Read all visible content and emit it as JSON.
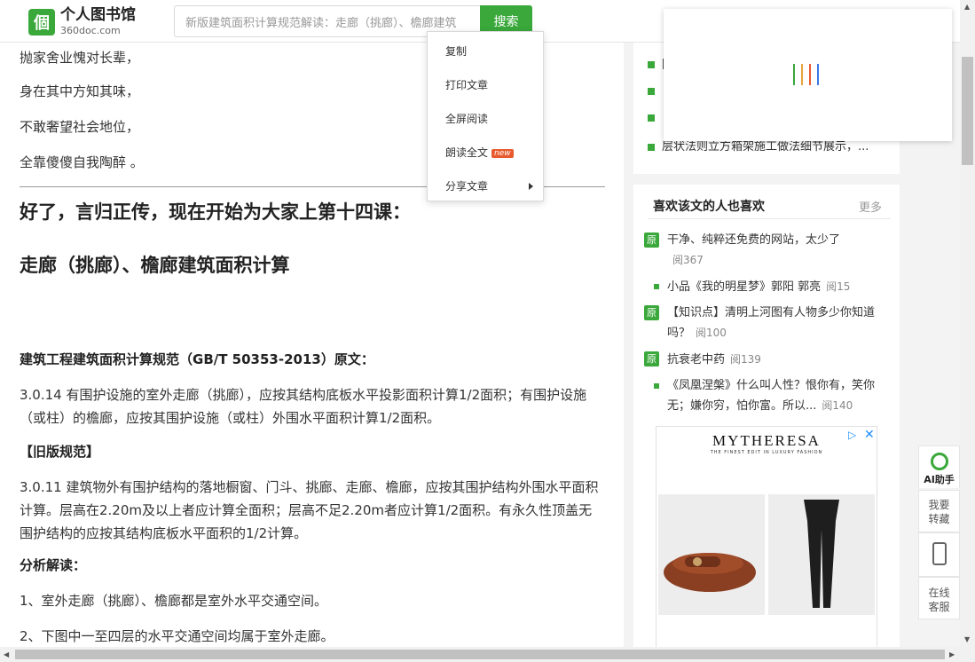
{
  "header": {
    "logo_mark": "個",
    "logo_title": "个人图书馆",
    "logo_sub": "360doc.com",
    "search_placeholder": "新版建筑面积计算规范解读：走廊（挑廊）、檐廊建筑",
    "search_button": "搜索"
  },
  "article": {
    "lines": [
      "抛家舍业愧对长辈，",
      "身在其中方知其味，",
      "不敢奢望社会地位，",
      "全靠傻傻自我陶醉 。"
    ],
    "heading1": "好了，言归正传，现在开始为大家上第十四课：",
    "heading2": "走廊（挑廊）、檐廊建筑面积计算",
    "spec_title": "建筑工程建筑面积计算规范（GB/T 50353-2013）原文：",
    "spec_text": "3.0.14 有围护设施的室外走廊（挑廊），应按其结构底板水平投影面积计算1/2面积；有围护设施（或柱）的檐廊，应按其围护设施（或柱）外围水平面积计算1/2面积。",
    "old_title": "【旧版规范】",
    "old_text": "3.0.11 建筑物外有围护结构的落地橱窗、门斗、挑廊、走廊、檐廊，应按其围护结构外围水平面积计算。层高在2.20m及以上者应计算全面积；层高不足2.20m者应计算1/2面积。有永久性顶盖无围护结构的应按其结构底板水平面积的1/2计算。",
    "analysis_title": "分析解读：",
    "point1": "1、室外走廊（挑廊）、檐廊都是室外水平交通空间。",
    "point2": "2、下图中一至四层的水平交通空间均属于室外走廊。"
  },
  "sidebar_top": {
    "items": [
      "[",
      "",
      "",
      "层状法则立方箱架施工做法细节展示，..."
    ]
  },
  "recommend": {
    "title": "喜欢该文的人也喜欢",
    "more": "更多",
    "badge": "原",
    "items": [
      {
        "badge": true,
        "text": "干净、纯粹还免费的网站，太少了",
        "reads": "阅367"
      },
      {
        "badge": false,
        "text": "小品《我的明星梦》郭阳 郭亮",
        "reads": "阅15"
      },
      {
        "badge": true,
        "text": "【知识点】清明上河图有人物多少你知道吗？",
        "reads": "阅100"
      },
      {
        "badge": true,
        "text": "抗衰老中药",
        "reads": "阅139"
      },
      {
        "badge": false,
        "text": "《凤凰涅槃》什么叫人性？恨你有，笑你无；嫌你穷，怕你富。所以...",
        "reads": "阅140"
      }
    ]
  },
  "ad": {
    "brand": "MYTHERESA",
    "tagline": "THE FINEST EDIT IN LUXURY FASHION"
  },
  "tools": {
    "ai": "AI助手",
    "save": [
      "我要",
      "转藏"
    ],
    "service": [
      "在线",
      "客服"
    ]
  },
  "context_menu": {
    "items": [
      "复制",
      "打印文章",
      "全屏阅读",
      "朗读全文",
      "分享文章"
    ],
    "new_badge": "new"
  },
  "colors": {
    "brand_green": "#3aa83a",
    "new_badge": "#e85a2e",
    "loader": [
      "#3aa83a",
      "#e8a33a",
      "#e85a2e",
      "#3a78e8"
    ]
  }
}
